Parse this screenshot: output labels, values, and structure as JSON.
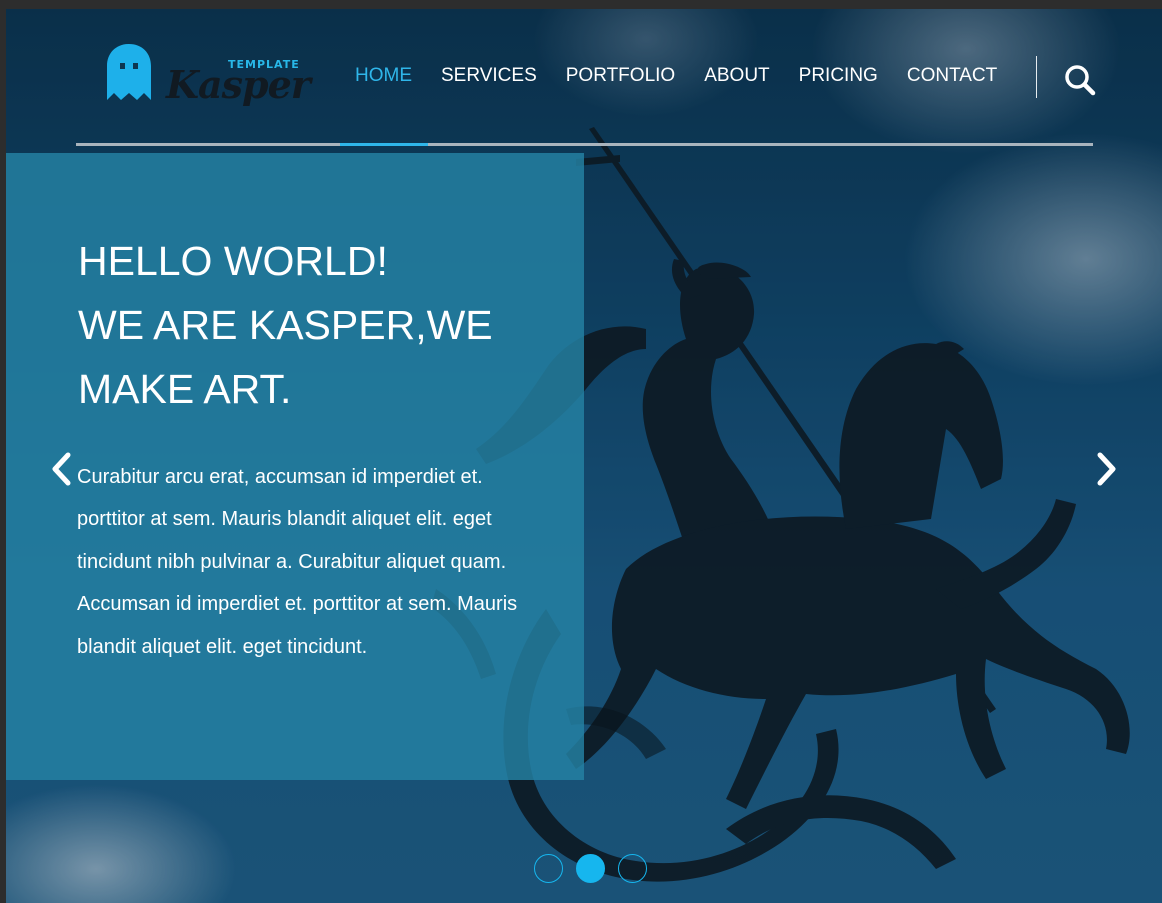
{
  "brand": {
    "tag": "TEMPLATE",
    "name": "Kasper",
    "accent": "#2fb6ea"
  },
  "nav": {
    "items": [
      {
        "label": "HOME",
        "active": true
      },
      {
        "label": "SERVICES",
        "active": false
      },
      {
        "label": "PORTFOLIO",
        "active": false
      },
      {
        "label": "ABOUT",
        "active": false
      },
      {
        "label": "PRICING",
        "active": false
      },
      {
        "label": "CONTACT",
        "active": false
      }
    ],
    "search_icon": "search-icon"
  },
  "hero": {
    "title_lines": [
      "HELLO WORLD!",
      "WE ARE KASPER,WE",
      "MAKE ART."
    ],
    "body": "Curabitur arcu erat, accumsan id imperdiet et. porttitor at sem. Mauris blandit aliquet elit. eget tincidunt nibh pulvinar a. Curabitur aliquet quam. Accumsan id imperdiet et. porttitor at sem. Mauris blandit aliquet elit. eget tincidunt.",
    "panel_color": "#2482a5"
  },
  "slider": {
    "prev_icon": "chevron-left-icon",
    "next_icon": "chevron-right-icon",
    "slide_count": 3,
    "active_slide": 2,
    "dot_color": "#16b6ee"
  }
}
